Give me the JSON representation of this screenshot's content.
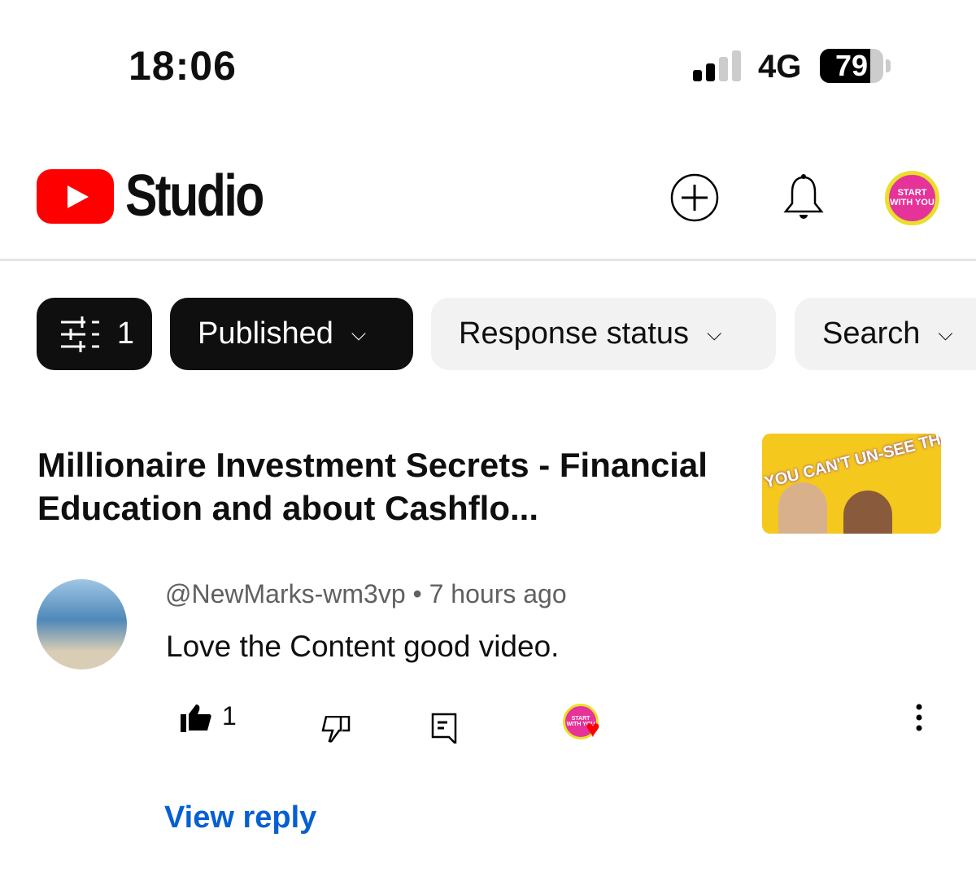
{
  "status_bar": {
    "time": "18:06",
    "network": "4G",
    "battery": "79",
    "battery_level_percent": 79,
    "signal_bars": 2
  },
  "header": {
    "app_name": "Studio",
    "icons": [
      "create-icon",
      "bell-icon",
      "channel-avatar"
    ],
    "avatar_text": "START WITH YOU"
  },
  "filters": {
    "filter_count": "1",
    "chips": [
      {
        "label": "Published"
      },
      {
        "label": "Response status"
      },
      {
        "label": "Search"
      }
    ]
  },
  "video": {
    "title": "Millionaire Investment Secrets - Financial Education and about Cashflo...",
    "thumbnail_text": "YOU CAN'T UN-SEE THIS!! E B S I"
  },
  "comment": {
    "author": "@NewMarks-wm3vp",
    "separator": "•",
    "time": "7 hours ago",
    "text": "Love the Content good video.",
    "likes": "1",
    "hearted_by_text": "START WITH YOU"
  },
  "view_reply": "View reply",
  "colors": {
    "brand_red": "#ff0000",
    "link_blue": "#065fd4",
    "heart": "#ff0000"
  }
}
